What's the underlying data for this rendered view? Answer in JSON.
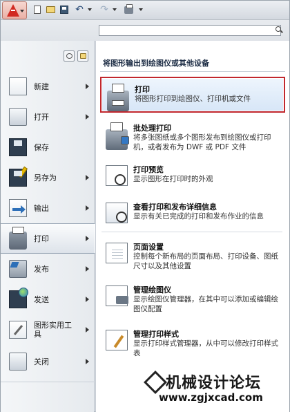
{
  "search": {
    "placeholder": ""
  },
  "quick_access": {
    "icons": [
      "new-icon",
      "open-icon",
      "save-icon",
      "undo-icon",
      "redo-icon",
      "plot-icon"
    ]
  },
  "left_menu": {
    "items": [
      {
        "label": "新建",
        "icon": "new-document-icon",
        "has_submenu": true
      },
      {
        "label": "打开",
        "icon": "open-folder-icon",
        "has_submenu": true
      },
      {
        "label": "保存",
        "icon": "save-icon",
        "has_submenu": false
      },
      {
        "label": "另存为",
        "icon": "save-as-icon",
        "has_submenu": true
      },
      {
        "label": "输出",
        "icon": "export-icon",
        "has_submenu": true
      },
      {
        "label": "打印",
        "icon": "printer-icon",
        "has_submenu": true,
        "active": true
      },
      {
        "label": "发布",
        "icon": "publish-icon",
        "has_submenu": true
      },
      {
        "label": "发送",
        "icon": "send-icon",
        "has_submenu": true
      },
      {
        "label": "图形实用工具",
        "icon": "drawing-utilities-icon",
        "has_submenu": true
      },
      {
        "label": "关闭",
        "icon": "close-document-icon",
        "has_submenu": true
      }
    ]
  },
  "panel": {
    "heading": "将图形输出到绘图仪或其他设备",
    "options": [
      {
        "title": "打印",
        "desc": "将图形打印到绘图仪、打印机或文件",
        "icon": "printer-icon",
        "selected": true
      },
      {
        "title": "批处理打印",
        "desc": "将多张图纸或多个图形发布到绘图仪或打印机，或者发布为 DWF 或 PDF 文件",
        "icon": "batch-plot-icon"
      },
      {
        "title": "打印预览",
        "desc": "显示图形在打印时的外观",
        "icon": "plot-preview-icon"
      },
      {
        "title": "查看打印和发布详细信息",
        "desc": "显示有关已完成的打印和发布作业的信息",
        "icon": "plot-details-icon"
      },
      {
        "title": "页面设置",
        "desc": "控制每个新布局的页面布局、打印设备、图纸尺寸以及其他设置",
        "icon": "page-setup-icon"
      },
      {
        "title": "管理绘图仪",
        "desc": "显示绘图仪管理器，在其中可以添加或编辑绘图仪配置",
        "icon": "plotter-manager-icon"
      },
      {
        "title": "管理打印样式",
        "desc": "显示打印样式管理器，从中可以修改打印样式表",
        "icon": "plot-style-manager-icon"
      }
    ]
  },
  "watermark": {
    "title": "机械设计论坛",
    "url": "www.zgjxcad.com"
  },
  "colors": {
    "selection_border": "#c1272d",
    "selection_fill": "#dbe8f7",
    "logo_red": "#d12a22"
  }
}
